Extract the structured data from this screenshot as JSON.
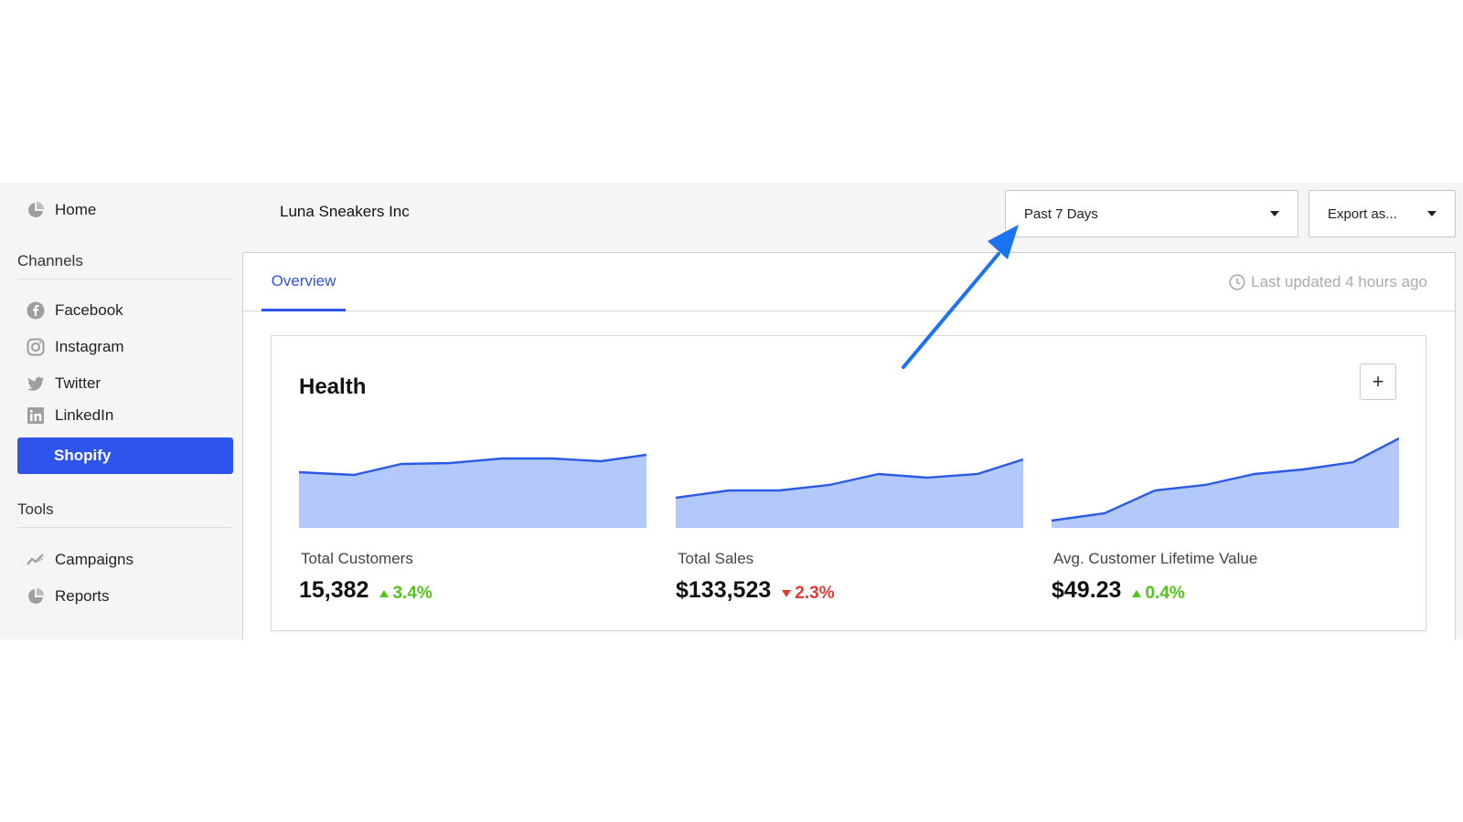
{
  "sidebar": {
    "home": {
      "label": "Home",
      "icon": "pie-chart-icon"
    },
    "channels_title": "Channels",
    "channels": [
      {
        "label": "Facebook",
        "icon": "facebook-icon"
      },
      {
        "label": "Instagram",
        "icon": "instagram-icon"
      },
      {
        "label": "Twitter",
        "icon": "twitter-icon"
      },
      {
        "label": "LinkedIn",
        "icon": "linkedin-icon"
      },
      {
        "label": "Shopify",
        "active": true
      }
    ],
    "tools_title": "Tools",
    "tools": [
      {
        "label": "Campaigns",
        "icon": "trend-line-icon"
      },
      {
        "label": "Reports",
        "icon": "pie-chart-icon"
      }
    ]
  },
  "header": {
    "company": "Luna Sneakers Inc",
    "date_range": "Past 7 Days",
    "export": "Export as..."
  },
  "tabs": [
    {
      "label": "Overview",
      "active": true
    }
  ],
  "last_updated": "Last updated 4 hours ago",
  "health": {
    "title": "Health",
    "add_label": "+",
    "metrics": [
      {
        "label": "Total Customers",
        "value": "15,382",
        "delta": "3.4%",
        "direction": "up"
      },
      {
        "label": "Total Sales",
        "value": "$133,523",
        "delta": "2.3%",
        "direction": "down"
      },
      {
        "label": "Avg. Customer Lifetime Value",
        "value": "$49.23",
        "delta": "0.4%",
        "direction": "up"
      }
    ]
  },
  "colors": {
    "accent": "#2f54eb",
    "area_fill": "#b3c8fb",
    "area_line": "#2b5ae5",
    "positive": "#52c41a",
    "negative": "#e53935",
    "annotation_arrow": "#1a73f0"
  }
}
